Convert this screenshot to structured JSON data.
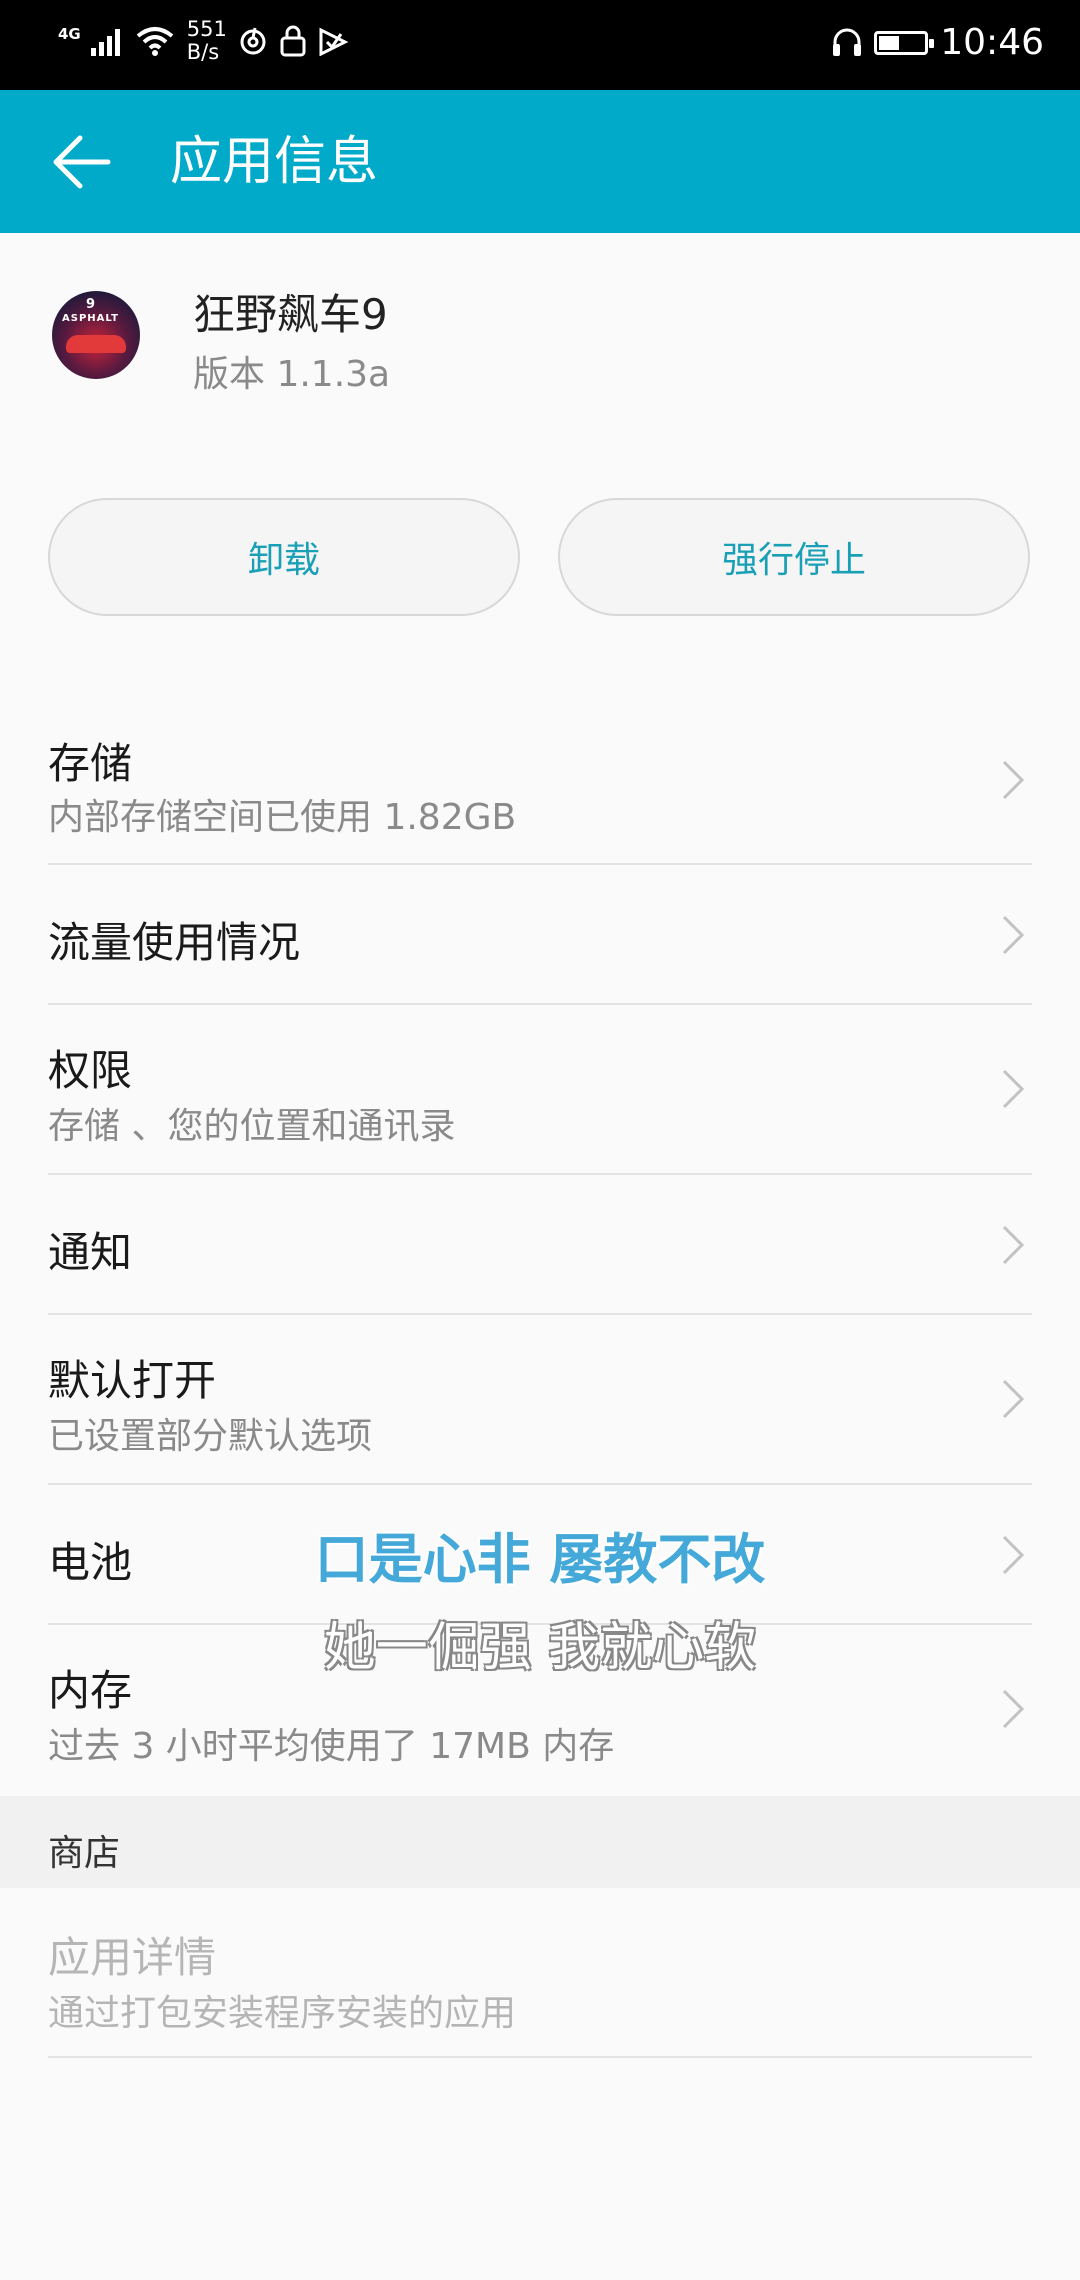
{
  "status_bar": {
    "network": "4G",
    "speed_value": "551",
    "speed_unit": "B/s",
    "time": "10:46",
    "battery_level": 0.45
  },
  "app_bar": {
    "title": "应用信息"
  },
  "app": {
    "name": "狂野飙车9",
    "version": "版本 1.1.3a",
    "icon_badge": "9",
    "icon_brand": "ASPHALT"
  },
  "actions": {
    "uninstall": "卸载",
    "force_stop": "强行停止"
  },
  "settings": [
    {
      "title": "存储",
      "subtitle": "内部存储空间已使用 1.82GB"
    },
    {
      "title": "流量使用情况",
      "subtitle": ""
    },
    {
      "title": "权限",
      "subtitle": "存储 、您的位置和通讯录"
    },
    {
      "title": "通知",
      "subtitle": ""
    },
    {
      "title": "默认打开",
      "subtitle": "已设置部分默认选项"
    },
    {
      "title": "电池",
      "subtitle": ""
    },
    {
      "title": "内存",
      "subtitle": "过去 3 小时平均使用了 17MB 内存"
    }
  ],
  "store_section": {
    "header": "商店",
    "title": "应用详情",
    "subtitle": "通过打包安装程序安装的应用"
  },
  "captions": {
    "line1": "口是心非 屡教不改",
    "line2": "她一倔强 我就心软"
  },
  "colors": {
    "app_bar": "#00aac8",
    "accent_text": "#1aa0b6"
  }
}
